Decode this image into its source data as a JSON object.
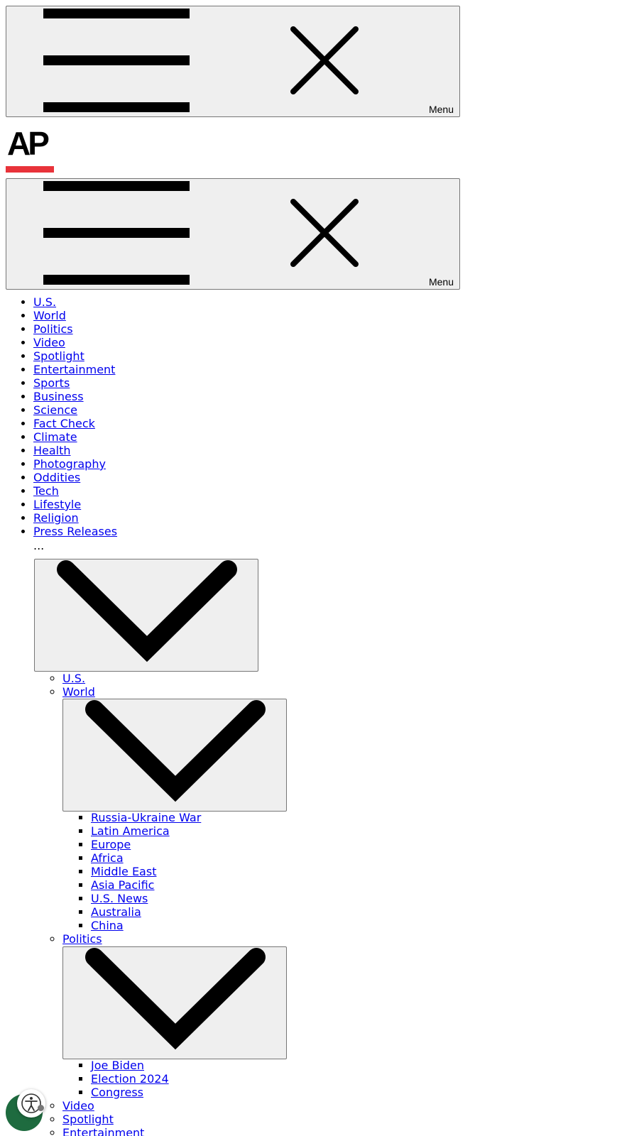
{
  "header": {
    "menu_label": "Menu",
    "logo_text": "AP",
    "brand_color": "#e8333a"
  },
  "nav": {
    "items": [
      {
        "label": "U.S."
      },
      {
        "label": "World"
      },
      {
        "label": "Politics"
      },
      {
        "label": "Video"
      },
      {
        "label": "Spotlight"
      },
      {
        "label": "Entertainment"
      },
      {
        "label": "Sports"
      },
      {
        "label": "Business"
      },
      {
        "label": "Science"
      },
      {
        "label": "Fact Check"
      },
      {
        "label": "Climate"
      },
      {
        "label": "Health"
      },
      {
        "label": "Photography"
      },
      {
        "label": "Oddities"
      },
      {
        "label": "Tech"
      },
      {
        "label": "Lifestyle"
      },
      {
        "label": "Religion"
      },
      {
        "label": "Press Releases"
      }
    ],
    "more_label": "..."
  },
  "more_menu": {
    "items": [
      {
        "label": "U.S."
      },
      {
        "label": "World"
      },
      {
        "label": "Politics"
      },
      {
        "label": "Video"
      },
      {
        "label": "Spotlight"
      },
      {
        "label": "Entertainment"
      }
    ],
    "world_sub": [
      {
        "label": "Russia-Ukraine War"
      },
      {
        "label": "Latin America"
      },
      {
        "label": "Europe"
      },
      {
        "label": "Africa"
      },
      {
        "label": "Middle East"
      },
      {
        "label": "Asia Pacific"
      },
      {
        "label": "U.S. News"
      },
      {
        "label": "Australia"
      },
      {
        "label": "China"
      }
    ],
    "politics_sub": [
      {
        "label": "Joe Biden"
      },
      {
        "label": "Election 2024"
      },
      {
        "label": "Congress"
      }
    ]
  },
  "icons": {
    "hamburger": "hamburger-icon",
    "close": "close-icon",
    "chevron": "chevron-down-icon",
    "accessibility": "accessibility-icon"
  }
}
